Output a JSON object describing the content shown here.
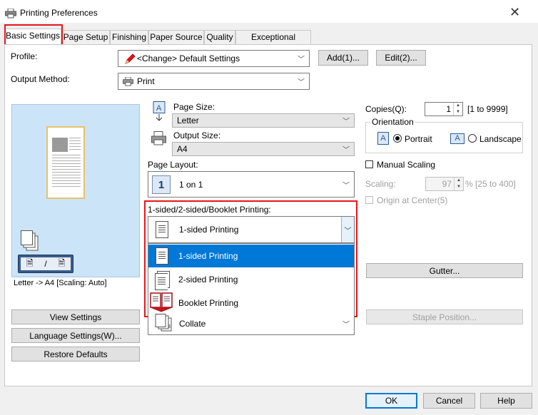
{
  "window": {
    "title": "Printing Preferences",
    "close": "✕"
  },
  "tabs": [
    "Basic Settings",
    "Page Setup",
    "Finishing",
    "Paper Source",
    "Quality",
    "Exceptional Settings"
  ],
  "profile": {
    "label": "Profile:",
    "value": "<Change> Default Settings",
    "add_button": "Add(1)...",
    "edit_button": "Edit(2)..."
  },
  "output_method": {
    "label": "Output Method:",
    "value": "Print"
  },
  "page_size": {
    "label": "Page Size:",
    "value": "Letter"
  },
  "output_size": {
    "label": "Output Size:",
    "value": "A4"
  },
  "page_layout": {
    "label": "Page Layout:",
    "value": "1 on 1",
    "icon_text": "1"
  },
  "sided": {
    "label": "1-sided/2-sided/Booklet Printing:",
    "value": "1-sided Printing",
    "options": [
      "1-sided Printing",
      "2-sided Printing",
      "Booklet Printing"
    ],
    "selected_index": 0
  },
  "collate": {
    "value": "Collate"
  },
  "preview": {
    "status": "Letter -> A4 [Scaling: Auto]"
  },
  "copies": {
    "label": "Copies(Q):",
    "value": "1",
    "range": "[1 to 9999]"
  },
  "orientation": {
    "label": "Orientation",
    "portrait": "Portrait",
    "landscape": "Landscape",
    "icon_letter": "A",
    "selected": "portrait"
  },
  "manual_scaling": {
    "label": "Manual Scaling"
  },
  "scaling": {
    "label": "Scaling:",
    "value": "97",
    "range": "% [25 to 400]"
  },
  "origin_center": {
    "label": "Origin at Center(5)"
  },
  "gutter_button": "Gutter...",
  "staple_button": "Staple Position...",
  "left_buttons": {
    "view": "View Settings",
    "language": "Language Settings(W)...",
    "restore": "Restore Defaults"
  },
  "dialog_buttons": {
    "ok": "OK",
    "cancel": "Cancel",
    "help": "Help"
  },
  "colors": {
    "selection": "#0078d7",
    "highlight": "#e8141c",
    "preview_bg": "#cce4f7"
  }
}
